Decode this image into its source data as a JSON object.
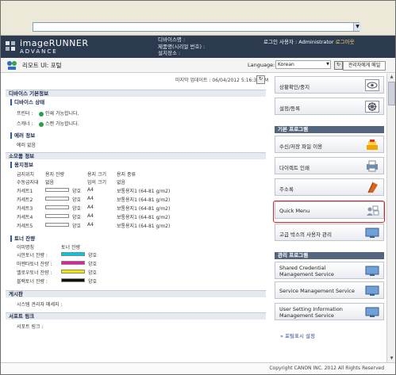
{
  "window": {
    "address_value": ""
  },
  "header": {
    "logo_line1": "imageRUNNER",
    "logo_line2": "ADVANCE",
    "device_name_label": "디바이스명 :",
    "product_label": "제품명(시리얼 번호) :",
    "location_label": "설치장소 :",
    "login_user_label": "로그인 사용자 : Administrator",
    "logout_label": "로그아웃"
  },
  "subbar": {
    "title": "리모트 UI: 포털",
    "language_label": "Language:",
    "language_value": "Korean",
    "admin_button": "관리자에게 메일"
  },
  "left": {
    "updated": "마지막 업데이트 : 06/04/2012 5:16:37 AM",
    "device_basic_header": "디바이스 기본정보",
    "device_status_header": "디바이스 상태",
    "printer_label": "프린터 :",
    "printer_status": "인쇄 가능합니다.",
    "scanner_label": "스캐너 :",
    "scanner_status": "스캔 가능합니다.",
    "error_info_header": "에러 정보",
    "error_info_text": "에러 없음",
    "consumables_header": "소모품 정보",
    "paper_info_header": "용지정보",
    "paper_cols": [
      "급지위치",
      "용지 잔량",
      "용지 크기",
      "용지 종류"
    ],
    "paper_rows": [
      {
        "source": "수동급지대",
        "level_text": "없음",
        "size": "임의 크기",
        "type": "없음",
        "level": null
      },
      {
        "source": "카세트1",
        "level_text": "양호",
        "size": "A4",
        "type": "보통용지1 (64-81 g/m2)",
        "level": 1.0
      },
      {
        "source": "카세트2",
        "level_text": "양호",
        "size": "A4",
        "type": "보통용지1 (64-81 g/m2)",
        "level": 1.0
      },
      {
        "source": "카세트3",
        "level_text": "양호",
        "size": "A4",
        "type": "보통용지1 (64-81 g/m2)",
        "level": 1.0
      },
      {
        "source": "카세트4",
        "level_text": "양호",
        "size": "A4",
        "type": "보통용지1 (64-81 g/m2)",
        "level": 1.0
      },
      {
        "source": "카세트5",
        "level_text": "양호",
        "size": "A4",
        "type": "보통용지1 (64-81 g/m2)",
        "level": 1.0
      }
    ],
    "toner_header": "토너 잔량",
    "toner_cols": [
      "이미명칭",
      "토너 잔량"
    ],
    "toner_rows": [
      {
        "name": "시안토너 잔량 :",
        "status": "양호",
        "color": "#00c8e8",
        "level": 1.0
      },
      {
        "name": "마젠타토너 잔량 :",
        "status": "양호",
        "color": "#e020a0",
        "level": 1.0
      },
      {
        "name": "옐로우토너 잔량 :",
        "status": "양호",
        "color": "#f2e600",
        "level": 1.0
      },
      {
        "name": "블랙토너 잔량 :",
        "status": "양호",
        "color": "#111111",
        "level": 1.0
      }
    ],
    "message_header": "게시판",
    "message_text": "시스템 관리자 메세지 :",
    "support_header": "서포트 링크",
    "support_text": "서포트 링크 :"
  },
  "right": {
    "btn_status": "상황확인/중지",
    "btn_settings": "설정/등록",
    "basic_header": "기본 프로그램",
    "btn_box": "수신/저장 파일 이용",
    "btn_direct_print": "다이렉트 인쇄",
    "btn_address": "주소록",
    "btn_quick_menu": "Quick Menu",
    "btn_advanced_box": "고급 박스의 사용자 관리",
    "mgmt_header": "관리 프로그램",
    "btn_credential": "Shared Credential Management Service",
    "btn_service_mgmt": "Service Management Service",
    "btn_user_setting": "User Setting Information Management Service",
    "portal_link": "포털표시 설정"
  },
  "footer": {
    "copyright": "Copyright CANON INC. 2012 All Rights Reserved"
  }
}
